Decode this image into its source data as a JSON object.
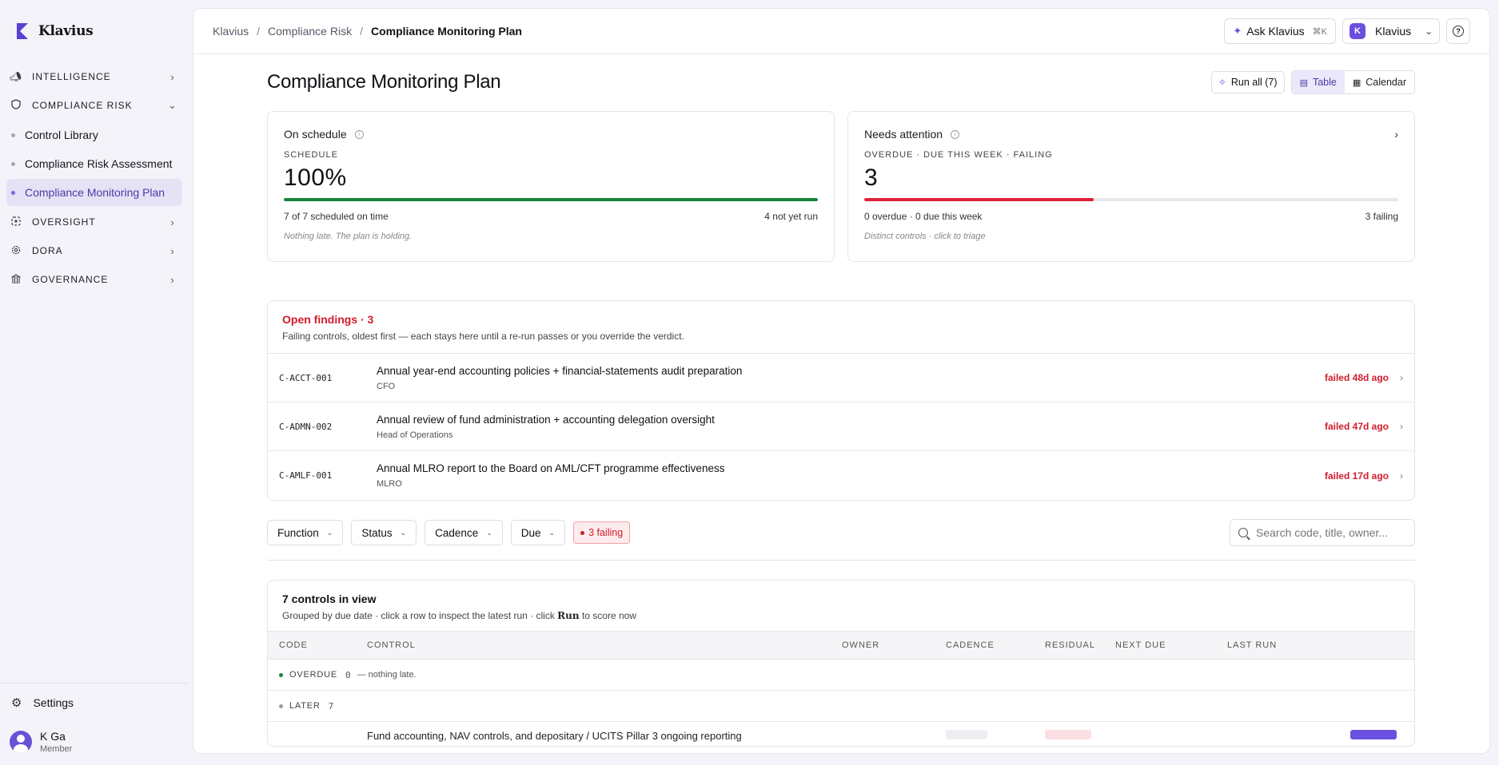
{
  "brand": {
    "name": "Klavius"
  },
  "sidebar": {
    "groups": [
      {
        "label": "INTELLIGENCE",
        "icon": "megaphone-icon"
      },
      {
        "label": "COMPLIANCE RISK",
        "icon": "shield-icon"
      },
      {
        "label": "OVERSIGHT",
        "icon": "scope-icon"
      },
      {
        "label": "DORA",
        "icon": "cog-icon"
      },
      {
        "label": "GOVERNANCE",
        "icon": "bank-icon"
      }
    ],
    "compliance_items": [
      "Control Library",
      "Compliance Risk Assessment",
      "Compliance Monitoring Plan"
    ],
    "active_item": "Compliance Monitoring Plan",
    "settings_label": "Settings",
    "user": {
      "name": "K Ga",
      "role": "Member"
    }
  },
  "topbar": {
    "breadcrumb": [
      "Klavius",
      "Compliance Risk",
      "Compliance Monitoring Plan"
    ],
    "ask_label": "Ask Klavius",
    "ask_shortcut": "⌘K",
    "workspace": "Klavius",
    "help": "?"
  },
  "page": {
    "title": "Compliance Monitoring Plan",
    "run_all_label": "Run all (7)",
    "view_tabs": [
      "Table",
      "Calendar"
    ],
    "active_view": "Table"
  },
  "cards": {
    "schedule": {
      "title": "On schedule",
      "kicker": "SCHEDULE",
      "value": "100%",
      "progress": 1.0,
      "color": "#16853a",
      "meta_left": "7 of 7 scheduled on time",
      "meta_right": "4 not yet run",
      "note": "Nothing late. The plan is holding."
    },
    "attention": {
      "title": "Needs attention",
      "kicker": "OVERDUE · DUE THIS WEEK · FAILING",
      "value": "3",
      "progress": 0.43,
      "color": "#e0203a",
      "meta_left": "0 overdue · 0 due this week",
      "meta_right": "3 failing",
      "note": "Distinct controls · click to triage"
    }
  },
  "findings": {
    "title": "Open findings · 3",
    "subtitle": "Failing controls, oldest first — each stays here until a re-run passes or you override the verdict.",
    "rows": [
      {
        "code": "C-ACCT-001",
        "title": "Annual year-end accounting policies + financial-statements audit preparation",
        "owner": "CFO",
        "status": "failed 48d ago"
      },
      {
        "code": "C-ADMN-002",
        "title": "Annual review of fund administration + accounting delegation oversight",
        "owner": "Head of Operations",
        "status": "failed 47d ago"
      },
      {
        "code": "C-AMLF-001",
        "title": "Annual MLRO report to the Board on AML/CFT programme effectiveness",
        "owner": "MLRO",
        "status": "failed 17d ago"
      }
    ]
  },
  "filters": {
    "dropdowns": [
      "Function",
      "Status",
      "Cadence",
      "Due"
    ],
    "failing_chip": "3 failing",
    "search_placeholder": "Search code, title, owner..."
  },
  "controls": {
    "title": "7 controls in view",
    "subtitle_pre": "Grouped by due date · click a row to inspect the latest run · click",
    "subtitle_bold": "Run",
    "subtitle_post": "to score now",
    "columns": [
      "CODE",
      "CONTROL",
      "OWNER",
      "CADENCE",
      "RESIDUAL",
      "NEXT DUE",
      "LAST RUN"
    ],
    "groups": [
      {
        "label": "OVERDUE",
        "count": "0",
        "note": "— nothing late.",
        "color": "#16853a"
      },
      {
        "label": "LATER",
        "count": "7",
        "note": "",
        "color": "#9a9ca6"
      }
    ],
    "partial_row_text": "Fund accounting, NAV controls, and depositary / UCITS Pillar 3 ongoing reporting"
  },
  "colors": {
    "accent": "#6b4fe0",
    "danger": "#d21c2a",
    "success": "#16853a"
  }
}
